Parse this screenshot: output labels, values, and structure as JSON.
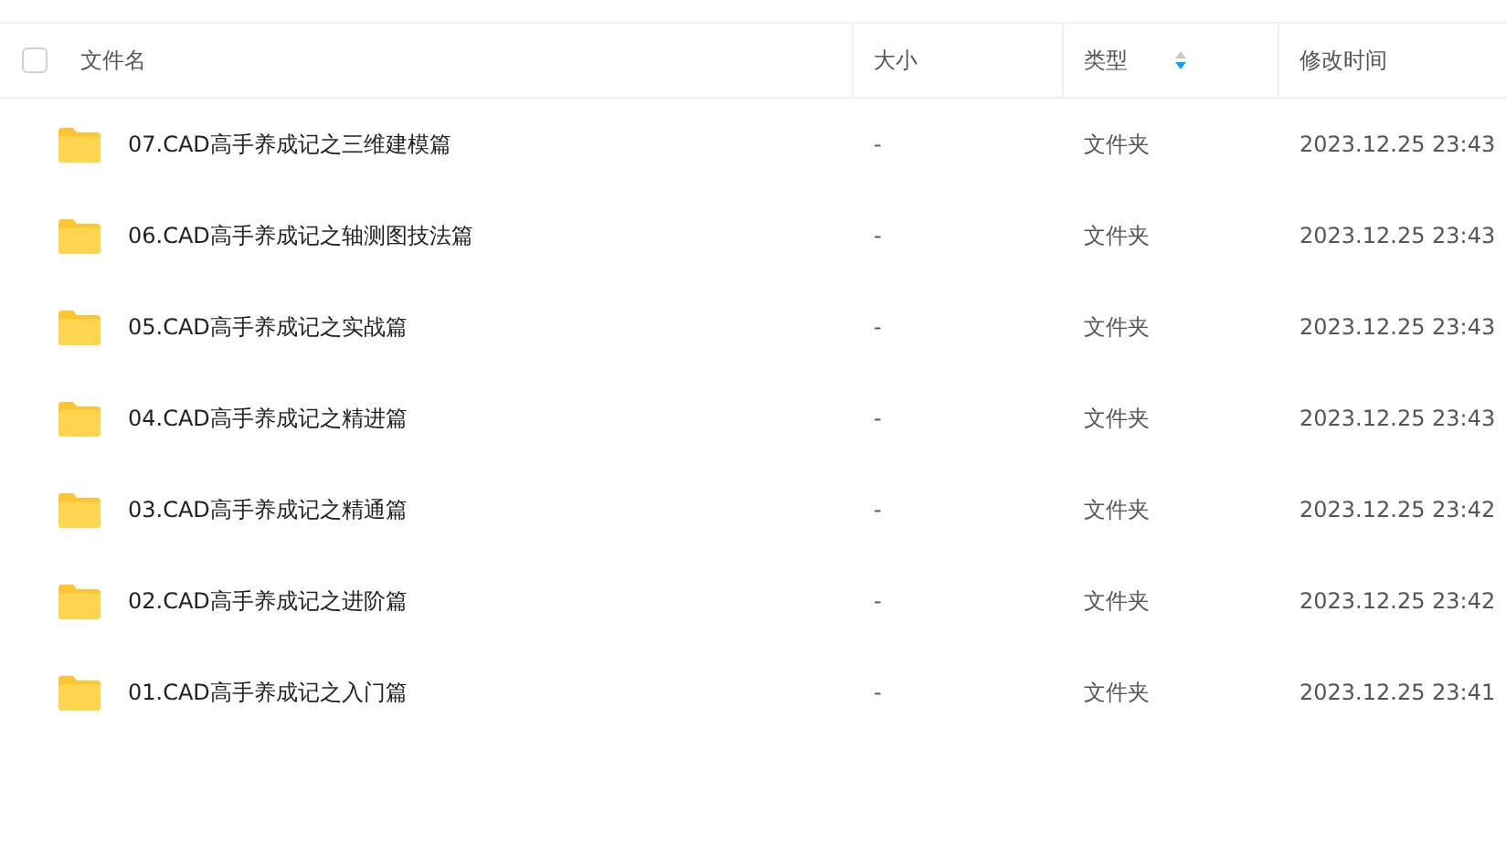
{
  "table": {
    "select_all": {
      "checked": false
    },
    "columns": [
      {
        "label": "文件名",
        "sorted": false
      },
      {
        "label": "大小",
        "sorted": false
      },
      {
        "label": "类型",
        "sorted": true
      },
      {
        "label": "修改时间",
        "sorted": false
      }
    ],
    "rows": [
      {
        "name": "07.CAD高手养成记之三维建模篇",
        "size": "-",
        "type": "文件夹",
        "modified": "2023.12.25 23:43"
      },
      {
        "name": "06.CAD高手养成记之轴测图技法篇",
        "size": "-",
        "type": "文件夹",
        "modified": "2023.12.25 23:43"
      },
      {
        "name": "05.CAD高手养成记之实战篇",
        "size": "-",
        "type": "文件夹",
        "modified": "2023.12.25 23:43"
      },
      {
        "name": "04.CAD高手养成记之精进篇",
        "size": "-",
        "type": "文件夹",
        "modified": "2023.12.25 23:43"
      },
      {
        "name": "03.CAD高手养成记之精通篇",
        "size": "-",
        "type": "文件夹",
        "modified": "2023.12.25 23:42"
      },
      {
        "name": "02.CAD高手养成记之进阶篇",
        "size": "-",
        "type": "文件夹",
        "modified": "2023.12.25 23:42"
      },
      {
        "name": "01.CAD高手养成记之入门篇",
        "size": "-",
        "type": "文件夹",
        "modified": "2023.12.25 23:41"
      }
    ]
  }
}
